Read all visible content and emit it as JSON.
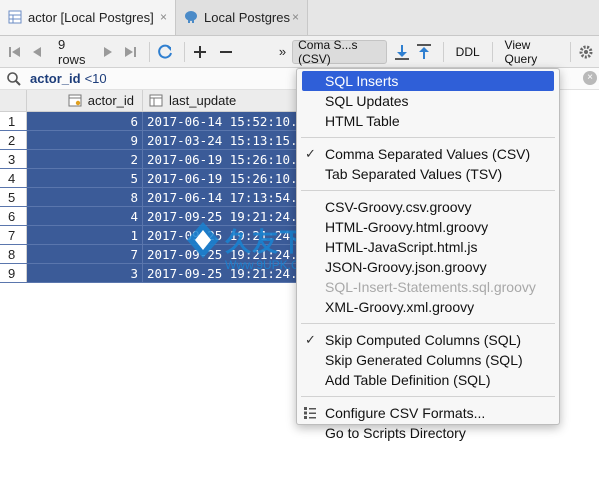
{
  "tabs": [
    {
      "label": "actor [Local Postgres]",
      "close": "×"
    },
    {
      "label": "Local Postgres",
      "close": "×"
    }
  ],
  "toolbar": {
    "rows_label": "9 rows",
    "more": "»",
    "format_label": "Coma S...s (CSV)",
    "ddl_label": "DDL",
    "view_query_label": "View Query"
  },
  "filter": {
    "column": "actor_id",
    "condition": "<10"
  },
  "grid": {
    "columns": [
      "actor_id",
      "last_update"
    ],
    "rows": [
      {
        "n": "1",
        "actor_id": "6",
        "last_update": "2017-06-14 15:52:10."
      },
      {
        "n": "2",
        "actor_id": "9",
        "last_update": "2017-03-24 15:13:15."
      },
      {
        "n": "3",
        "actor_id": "2",
        "last_update": "2017-06-19 15:26:10."
      },
      {
        "n": "4",
        "actor_id": "5",
        "last_update": "2017-06-19 15:26:10."
      },
      {
        "n": "5",
        "actor_id": "8",
        "last_update": "2017-06-14 17:13:54."
      },
      {
        "n": "6",
        "actor_id": "4",
        "last_update": "2017-09-25 19:21:24."
      },
      {
        "n": "7",
        "actor_id": "1",
        "last_update": "2017-09-25 19:21:24."
      },
      {
        "n": "8",
        "actor_id": "7",
        "last_update": "2017-09-25 19:21:24."
      },
      {
        "n": "9",
        "actor_id": "3",
        "last_update": "2017-09-25 19:21:24."
      }
    ]
  },
  "menu": {
    "group1": [
      "SQL Inserts",
      "SQL Updates",
      "HTML Table"
    ],
    "group2": [
      "Comma Separated Values (CSV)",
      "Tab Separated Values (TSV)"
    ],
    "group2_checked_index": 0,
    "group3": [
      "CSV-Groovy.csv.groovy",
      "HTML-Groovy.html.groovy",
      "HTML-JavaScript.html.js",
      "JSON-Groovy.json.groovy",
      "SQL-Insert-Statements.sql.groovy",
      "XML-Groovy.xml.groovy"
    ],
    "group4": [
      "Skip Computed Columns (SQL)",
      "Skip Generated Columns (SQL)",
      "Add Table Definition (SQL)"
    ],
    "group5": [
      "Configure CSV Formats...",
      "Go to Scripts Directory"
    ],
    "check_mark": "✓"
  },
  "watermark": {
    "title": "久友下载站",
    "url": "Www.9UPK.Com"
  },
  "colors": {
    "selection": "#3b5b98",
    "menu_highlight": "#2f5fd8",
    "accent_blue": "#1a82d0"
  }
}
